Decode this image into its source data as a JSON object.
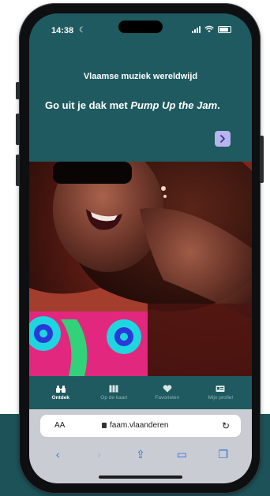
{
  "status": {
    "time": "14:38"
  },
  "header": {
    "title": "Vlaamse muziek wereldwijd"
  },
  "headline": {
    "prefix": "Go uit je dak met ",
    "song": "Pump Up the Jam",
    "suffix": "."
  },
  "nav": {
    "items": [
      {
        "label": "Ontdek",
        "active": true
      },
      {
        "label": "Op de kaart",
        "active": false
      },
      {
        "label": "Favorieten",
        "active": false
      },
      {
        "label": "Mijn profiel",
        "active": false
      }
    ]
  },
  "browser": {
    "text_size_label": "AA",
    "url": "faam.vlaanderen",
    "reload_icon": "reload-icon"
  },
  "colors": {
    "app_teal": "#1e5a5f",
    "accent_lavender": "#b8b4ee",
    "safari_blue": "#2f6fe0"
  }
}
